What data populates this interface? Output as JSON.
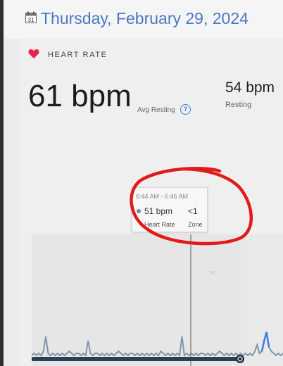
{
  "header": {
    "date_title": "Thursday, February 29, 2024",
    "calendar_icon": "calendar-icon",
    "calendar_day": "31"
  },
  "card": {
    "title": "HEART RATE",
    "heart_icon": "heart-icon",
    "bpm_main": "61 bpm",
    "avg_resting_label": "Avg Resting",
    "help_icon": "?",
    "resting_value": "54 bpm",
    "resting_label": "Resting"
  },
  "tooltip": {
    "time_range": "6:44 AM - 6:46 AM",
    "bpm": "51 bpm",
    "zone_value": "<1",
    "heart_rate_label": "Heart Rate",
    "zone_label": "Zone"
  },
  "chart_data": {
    "type": "line",
    "series": [
      {
        "values": [
          51,
          52,
          51,
          52,
          51,
          53,
          60,
          52,
          51,
          52,
          51,
          52,
          51,
          52,
          51,
          52,
          53,
          52,
          51,
          52,
          52,
          51,
          52,
          51,
          58,
          52,
          51,
          52,
          52,
          51,
          52,
          51,
          52,
          51,
          52,
          51,
          52,
          53,
          52,
          51,
          52,
          51,
          52,
          52,
          51,
          52,
          51,
          52,
          51,
          52,
          51,
          52,
          51,
          52,
          51,
          53,
          52,
          51,
          52,
          51,
          52,
          51,
          52,
          51,
          60,
          51,
          52,
          51,
          52,
          51,
          52,
          51,
          52,
          52,
          51,
          52,
          51,
          52,
          51,
          52,
          53,
          52,
          51,
          52,
          51,
          52,
          51,
          52,
          51,
          52,
          51,
          52,
          51,
          52,
          51,
          53,
          56,
          52,
          53,
          58,
          62,
          55,
          53,
          52,
          51,
          52,
          51,
          52
        ]
      }
    ],
    "selected_point": {
      "time": "6:44 AM - 6:46 AM",
      "value": 51
    },
    "colors": {
      "line": "#8096ab",
      "highlight": "#3a7de0",
      "scrub_bar": "#2d3f55",
      "annotation": "#e11b1b"
    }
  }
}
